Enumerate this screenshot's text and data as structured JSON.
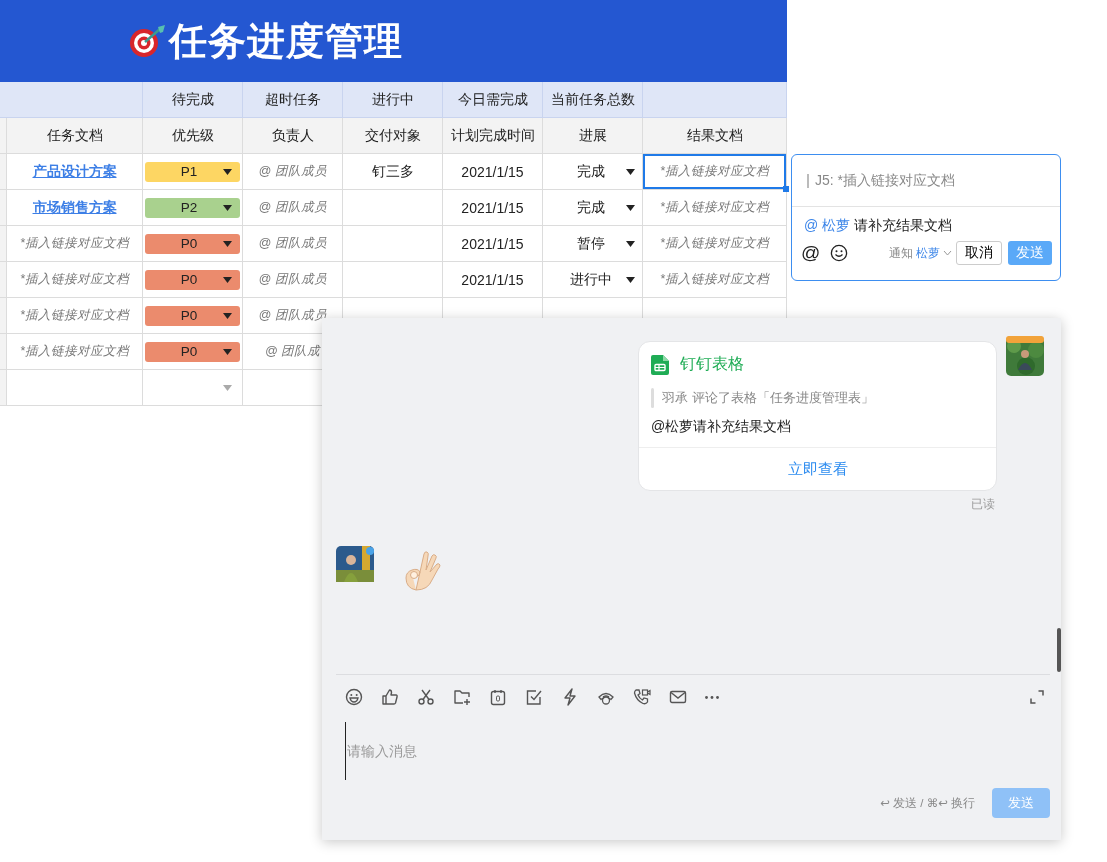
{
  "title": "任务进度管理",
  "sheet": {
    "summary_headers": [
      "待完成",
      "超时任务",
      "进行中",
      "今日需完成",
      "当前任务总数"
    ],
    "columns": [
      "任务文档",
      "优先级",
      "负责人",
      "交付对象",
      "计划完成时间",
      "进展",
      "结果文档"
    ],
    "rows": [
      {
        "kind": "task",
        "doc": {
          "text": "产品设计方案",
          "kind": "link"
        },
        "priority": {
          "label": "P1",
          "color": "#fdd663"
        },
        "owner": "@ 团队成员",
        "recipient": "钉三多",
        "due": "2021/1/15",
        "status": "完成",
        "result": {
          "text": "*插入链接对应文档",
          "selected": true
        }
      },
      {
        "kind": "task",
        "doc": {
          "text": "市场销售方案",
          "kind": "link"
        },
        "priority": {
          "label": "P2",
          "color": "#a9d18e"
        },
        "owner": "@ 团队成员",
        "due": "2021/1/15",
        "status": "完成",
        "result": {
          "text": "*插入链接对应文档",
          "selected": false
        }
      },
      {
        "kind": "task",
        "doc": {
          "text": "*插入链接对应文档",
          "kind": "placeholder"
        },
        "priority": {
          "label": "P0",
          "color": "#eb8b6d"
        },
        "owner": "@ 团队成员",
        "due": "2021/1/15",
        "status": "暂停",
        "result": {
          "text": "*插入链接对应文档",
          "selected": false
        }
      },
      {
        "kind": "task",
        "doc": {
          "text": "*插入链接对应文档",
          "kind": "placeholder"
        },
        "priority": {
          "label": "P0",
          "color": "#eb8b6d"
        },
        "owner": "@ 团队成员",
        "due": "2021/1/15",
        "status": "进行中",
        "result": {
          "text": "*插入链接对应文档",
          "selected": false
        }
      },
      {
        "kind": "task",
        "doc": {
          "text": "*插入链接对应文档",
          "kind": "placeholder"
        },
        "priority": {
          "label": "P0",
          "color": "#eb8b6d"
        },
        "owner": "@ 团队成员"
      },
      {
        "kind": "task",
        "doc": {
          "text": "*插入链接对应文档",
          "kind": "placeholder"
        },
        "priority": {
          "label": "P0",
          "color": "#eb8b6d"
        },
        "owner": "@ 团队成"
      },
      {
        "kind": "empty"
      }
    ]
  },
  "comment_popup": {
    "cell_ref": "J5: *插入链接对应文档",
    "mention": "@ 松萝",
    "message": "请补充结果文档",
    "at_button": "@",
    "notify_prefix": "通知",
    "notify_name": "松萝",
    "cancel": "取消",
    "send": "发送"
  },
  "chat": {
    "card": {
      "app": "钉钉表格",
      "quote": "羽承 评论了表格「任务进度管理表」",
      "body": "@松萝请补充结果文档",
      "action": "立即查看"
    },
    "read_receipt": "已读",
    "input": {
      "placeholder": "请输入消息"
    },
    "hint": "↩ 发送 / ⌘↩ 换行",
    "send": {
      "label": "发送",
      "disabled": true
    }
  }
}
